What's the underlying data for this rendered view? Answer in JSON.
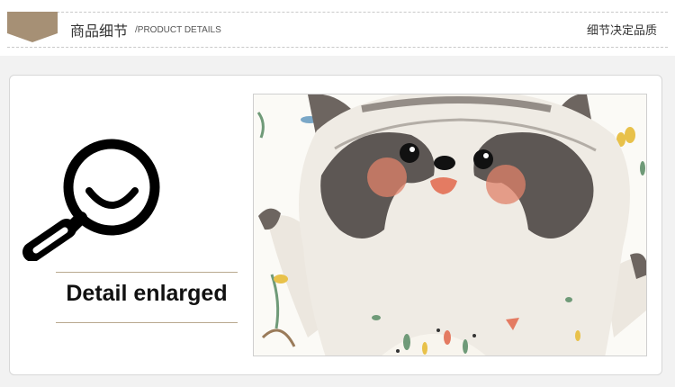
{
  "header": {
    "title": "商品细节",
    "subtitle": "/PRODUCT DETAILS",
    "slogan": "细节决定品质"
  },
  "detail": {
    "label": "Detail enlarged",
    "icon": "magnifier-smile-icon"
  },
  "image": {
    "subject": "raccoon-illustration"
  },
  "colors": {
    "badge": "#a69075",
    "rule": "#b9a98f",
    "page_bg": "#f2f2f2"
  }
}
